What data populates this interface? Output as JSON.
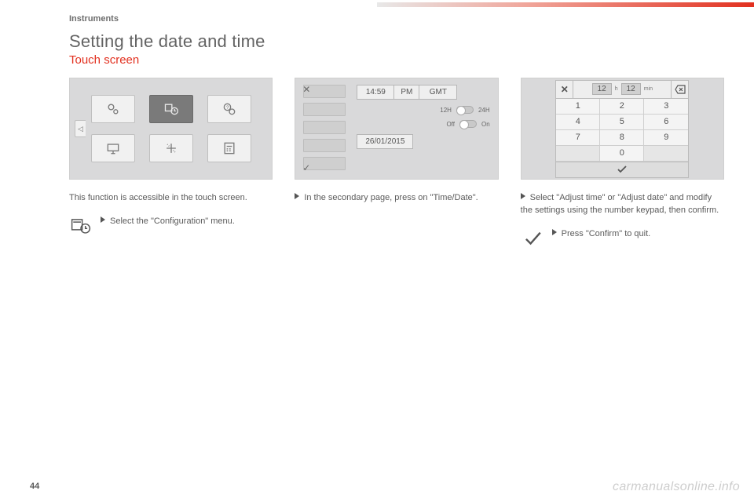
{
  "section": "Instruments",
  "title": "Setting the date and time",
  "subtitle": "Touch screen",
  "colA": {
    "caption": "This function is accessible in the touch screen.",
    "step": "Select the \"Configuration\" menu."
  },
  "colB": {
    "time": "14:59",
    "ampm": "PM",
    "tz": "GMT",
    "fmt12": "12H",
    "fmt24": "24H",
    "syncOff": "Off",
    "syncOn": "On",
    "date": "26/01/2015",
    "step": "In the secondary page, press on \"Time/Date\"."
  },
  "colC": {
    "hours": "12",
    "hUnit": "h",
    "minutes": "12",
    "mUnit": "min",
    "keys": [
      "1",
      "2",
      "3",
      "4",
      "5",
      "6",
      "7",
      "8",
      "9",
      "",
      "0",
      ""
    ],
    "step1": "Select \"Adjust time\" or \"Adjust date\" and modify the settings using the number keypad, then confirm.",
    "step2": "Press \"Confirm\" to quit."
  },
  "pageNumber": "44",
  "watermark": "carmanualsonline.info"
}
